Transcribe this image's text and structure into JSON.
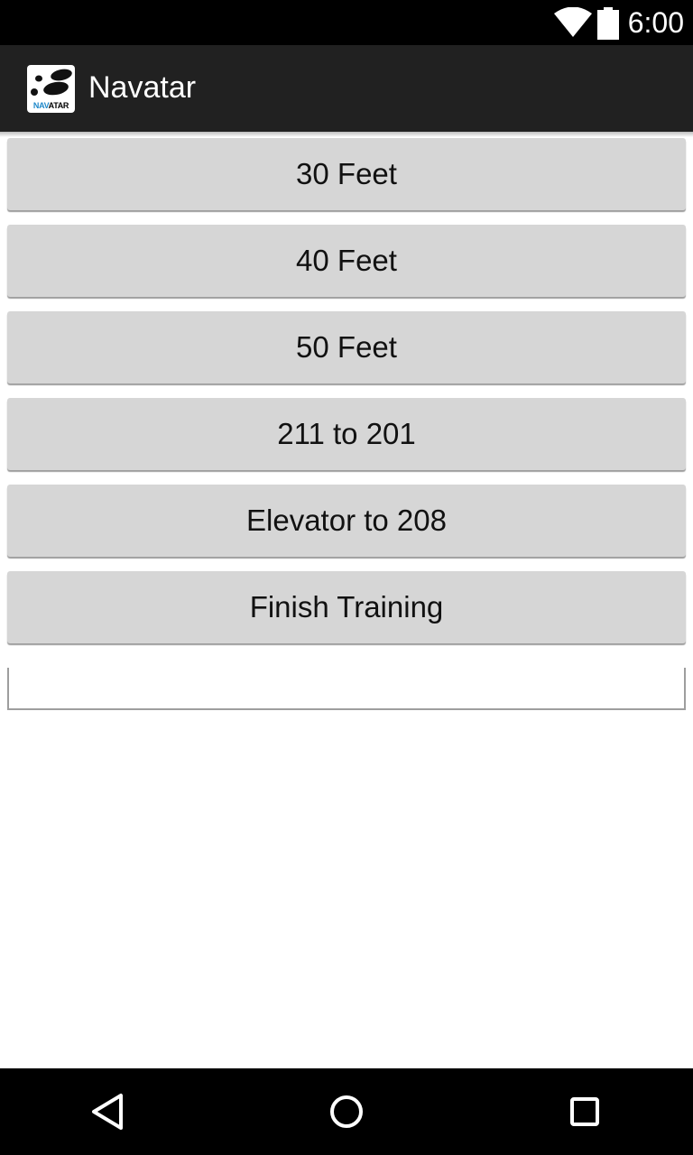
{
  "status_bar": {
    "time": "6:00",
    "icons": [
      "wifi-icon",
      "battery-icon"
    ]
  },
  "app_bar": {
    "title": "Navatar",
    "logo": {
      "icon": "navatar-logo-icon",
      "text_part1": "NAV",
      "text_part2": "ATAR",
      "colors": {
        "nav": "#1e88c9",
        "atar": "#000000"
      }
    }
  },
  "buttons": [
    {
      "label": "30 Feet"
    },
    {
      "label": "40 Feet"
    },
    {
      "label": "50 Feet"
    },
    {
      "label": "211 to 201"
    },
    {
      "label": "Elevator to 208"
    },
    {
      "label": "Finish Training"
    }
  ],
  "text_field": {
    "value": "",
    "placeholder": ""
  },
  "nav_bar": {
    "icons": [
      "back-icon",
      "home-icon",
      "recent-apps-icon"
    ]
  },
  "colors": {
    "status_bar": "#000000",
    "app_bar": "#212121",
    "button_bg": "#d6d6d6",
    "page_bg": "#ffffff"
  }
}
